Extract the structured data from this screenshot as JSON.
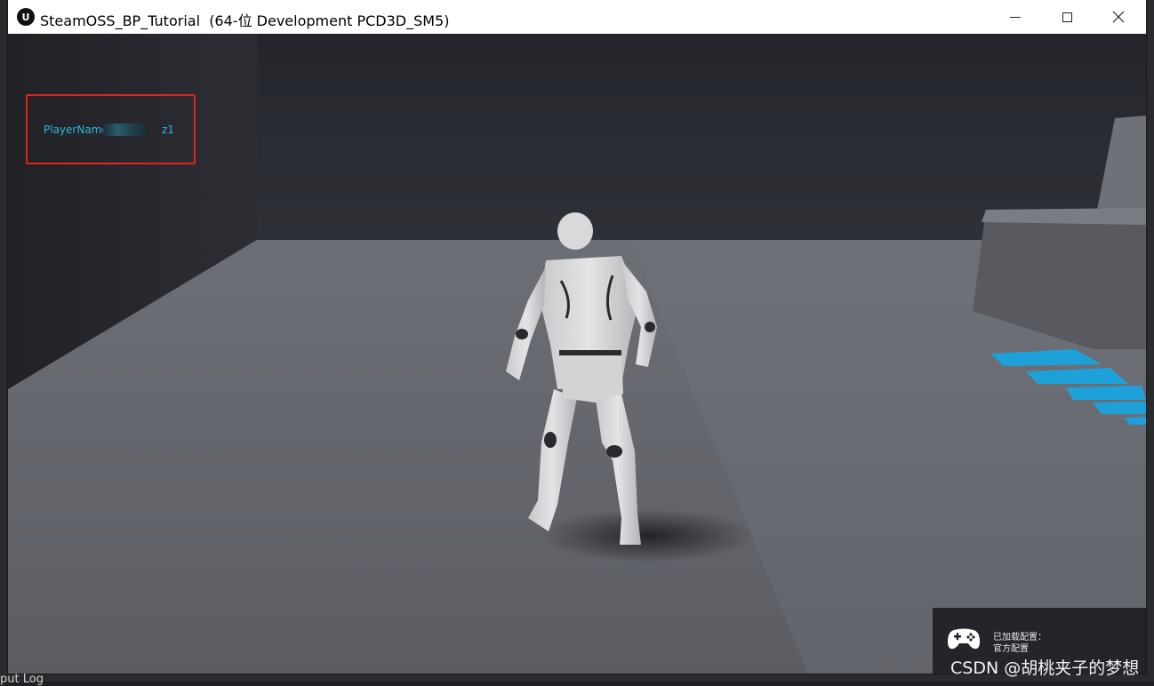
{
  "window": {
    "title": "SteamOSS_BP_Tutorial  (64-位 Development PCD3D_SM5)",
    "logo": "unreal-engine-logo"
  },
  "controls": {
    "minimize_icon": "minimize-icon",
    "maximize_icon": "maximize-icon",
    "close_icon": "close-icon"
  },
  "hud": {
    "player_name": "PlayerName:Gr           z1"
  },
  "notification": {
    "line1": "已加载配置：",
    "line2": "官方配置",
    "icon": "gamepad-icon"
  },
  "watermark": "CSDN @胡桃夹子的梦想",
  "bottom_log": "put Log",
  "colors": {
    "highlight_box": "#e0241b",
    "player_name_text": "#2fb4e0",
    "floor_marking": "#1ea0d8"
  }
}
